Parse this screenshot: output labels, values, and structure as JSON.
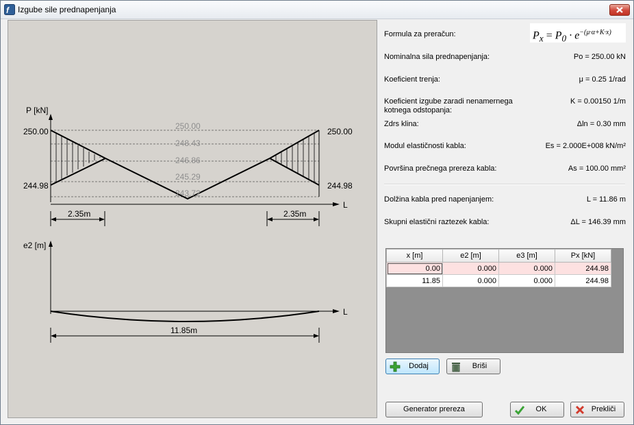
{
  "window": {
    "title": "Izgube sile prednapenjanja"
  },
  "properties": {
    "formula_label": "Formula za preračun:",
    "formula_lhs": "P",
    "formula_lhs_sub": "x",
    "formula_eq": " = ",
    "formula_p0": "P",
    "formula_p0_sub": "0",
    "formula_mid": " · e",
    "formula_exp": "−(μ·α+K·x)",
    "rows": [
      {
        "label": "Nominalna sila prednapenjanja:",
        "value": "Po = 250.00 kN"
      },
      {
        "label": "Koeficient trenja:",
        "value": "μ = 0.25 1/rad"
      },
      {
        "label": "Koeficient izgube zaradi nenamernega kotnega odstopanja:",
        "value": "K = 0.00150 1/m"
      },
      {
        "label": "Zdrs klina:",
        "value": "Δln = 0.30 mm"
      },
      {
        "label": "Modul elastičnosti kabla:",
        "value": "Es = 2.000E+008 kN/m²"
      },
      {
        "label": "Površina prečnega prereza kabla:",
        "value": "As = 100.00 mm²"
      },
      {
        "label": "Dolžina kabla pred napenjanjem:",
        "value": "L = 11.86 m"
      },
      {
        "label": "Skupni elastični raztezek kabla:",
        "value": "ΔL = 146.39 mm"
      }
    ]
  },
  "table": {
    "columns": [
      "x [m]",
      "e2 [m]",
      "e3 [m]",
      "Px [kN]"
    ],
    "rows": [
      [
        "0.00",
        "0.000",
        "0.000",
        "244.98"
      ],
      [
        "11.85",
        "0.000",
        "0.000",
        "244.98"
      ]
    ]
  },
  "buttons": {
    "add": "Dodaj",
    "delete": "Briši",
    "generator": "Generator prereza",
    "ok": "OK",
    "cancel": "Prekliči"
  },
  "diagram": {
    "force_axis_label": "P [kN]",
    "length_axis_label": "L",
    "left_top_value": "250.00",
    "left_bottom_value": "244.98",
    "right_top_value": "250.00",
    "right_bottom_value": "244.98",
    "level_labels": [
      "250.00",
      "248.43",
      "246.86",
      "245.29",
      "243.72"
    ],
    "left_draw_in": "2.35m",
    "right_draw_in": "2.35m",
    "ecc_axis_label": "e2 [m]",
    "ecc_length_label": "L",
    "total_length": "11.85m"
  },
  "colors": {
    "accent_red": "#d0473a",
    "selected_row": "#fde1e1",
    "canvas": "#d6d3ce"
  }
}
